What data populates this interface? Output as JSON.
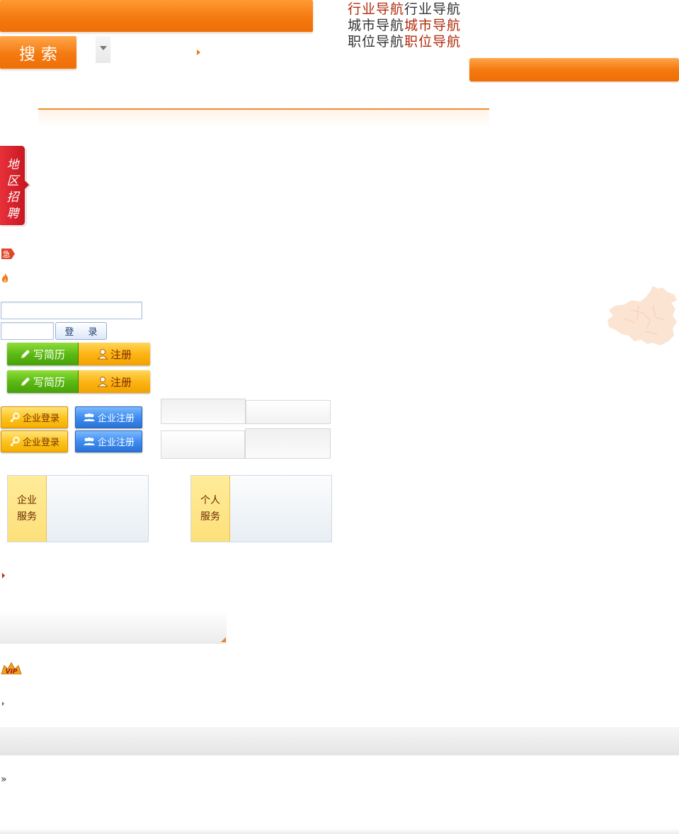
{
  "header": {
    "search_label": "搜索"
  },
  "nav": {
    "rows": [
      [
        "行业导航",
        "行业导航"
      ],
      [
        "城市导航",
        "城市导航"
      ],
      [
        "职位导航",
        "职位导航"
      ]
    ]
  },
  "region_tag": {
    "label": "地区招聘"
  },
  "badges": {
    "urgent": "急",
    "vip": "VIP"
  },
  "login": {
    "username_value": "",
    "password_value": "",
    "login_label": "登 录"
  },
  "resume_buttons": {
    "write_resume": "写简历",
    "register": "注册"
  },
  "corp_buttons": {
    "login": "企业登录",
    "register": "企业注册"
  },
  "services": {
    "enterprise": "企业服务",
    "personal": "个人服务"
  },
  "footer": {
    "raquo": "»"
  },
  "colors": {
    "brand_orange": "#f47a10",
    "nav_red": "#b12b0c",
    "green": "#5cba14",
    "yellow": "#fdb516",
    "blue": "#3d8df0"
  },
  "icons": [
    "caret-down-icon",
    "arrow-right-icon",
    "urgent-icon",
    "fire-icon",
    "china-map-icon",
    "pencil-icon",
    "user-icon",
    "key-icon",
    "users-icon",
    "vip-icon"
  ]
}
